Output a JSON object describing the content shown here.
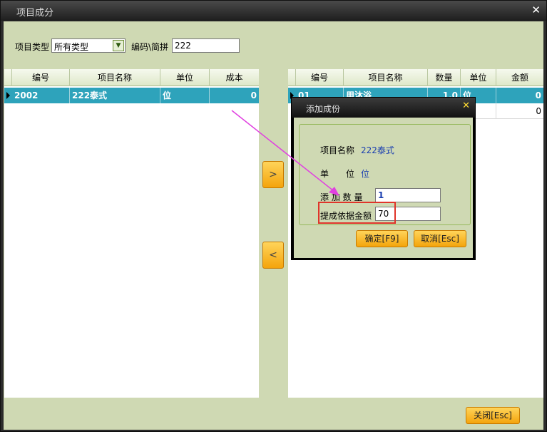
{
  "window": {
    "title": "项目成分",
    "close_glyph": "✕"
  },
  "filter": {
    "type_label": "项目类型",
    "type_value": "所有类型",
    "code_label": "编码\\简拼",
    "code_value": "222"
  },
  "left_table": {
    "columns": [
      "编号",
      "项目名称",
      "单位",
      "成本"
    ],
    "rows": [
      {
        "code": "2002",
        "name": "222泰式",
        "unit": "位",
        "cost": "0"
      }
    ]
  },
  "right_table": {
    "columns": [
      "编号",
      "项目名称",
      "数量",
      "单位",
      "金额"
    ],
    "rows": [
      {
        "code": "01",
        "name": "用沐浴",
        "qty": "1.0",
        "unit": "位",
        "amount": "0"
      },
      {
        "code": "",
        "name": "",
        "qty": "",
        "unit": "位",
        "amount": "0"
      }
    ]
  },
  "move_buttons": {
    "add_glyph": ">",
    "remove_glyph": "<"
  },
  "dialog": {
    "title": "添加成份",
    "close_glyph": "✕",
    "item_name_label": "项目名称",
    "item_name_value": "222泰式",
    "unit_label": "单　　位",
    "unit_value": "位",
    "qty_label": "添 加 数 量",
    "qty_value": "1",
    "amount_label": "提成依据金额",
    "amount_value": "70",
    "ok_label": "确定[F9]",
    "cancel_label": "取消[Esc]"
  },
  "footer": {
    "close_label": "关闭[Esc]"
  },
  "colors": {
    "panel_bg": "#cfd9b3",
    "selected_row": "#2ea3bb",
    "button_orange": "#f4a40c",
    "annotation_red": "#e0342a",
    "annotation_arrow": "#e040e0"
  }
}
